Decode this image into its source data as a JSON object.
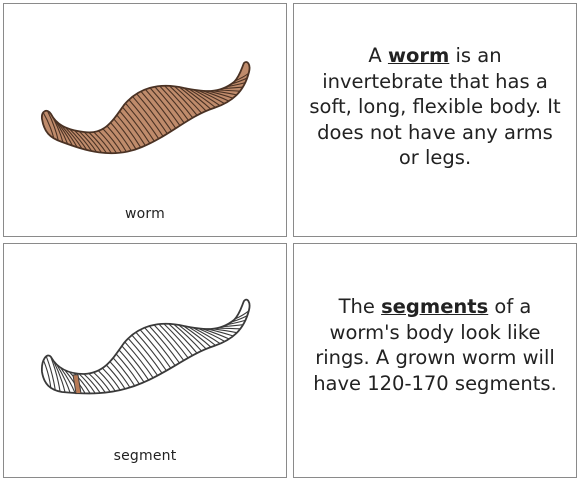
{
  "cards": [
    {
      "type": "picture",
      "label": "worm",
      "colors": {
        "body": "#bf8b6b",
        "outline": "#4a3224",
        "rings": "#4a3224"
      }
    },
    {
      "type": "definition",
      "text_before": "A ",
      "term": "worm",
      "text_after": " is an invertebrate that has a soft, long, flexible body. It does not have any arms or legs."
    },
    {
      "type": "picture",
      "label": "segment",
      "colors": {
        "body": "#ffffff",
        "outline": "#3a3a3a",
        "highlight": "#b87a55"
      }
    },
    {
      "type": "definition",
      "text_before": "The ",
      "term": "segments",
      "text_after": " of a worm's body look like rings. A grown worm will have 120-170 segments."
    }
  ]
}
